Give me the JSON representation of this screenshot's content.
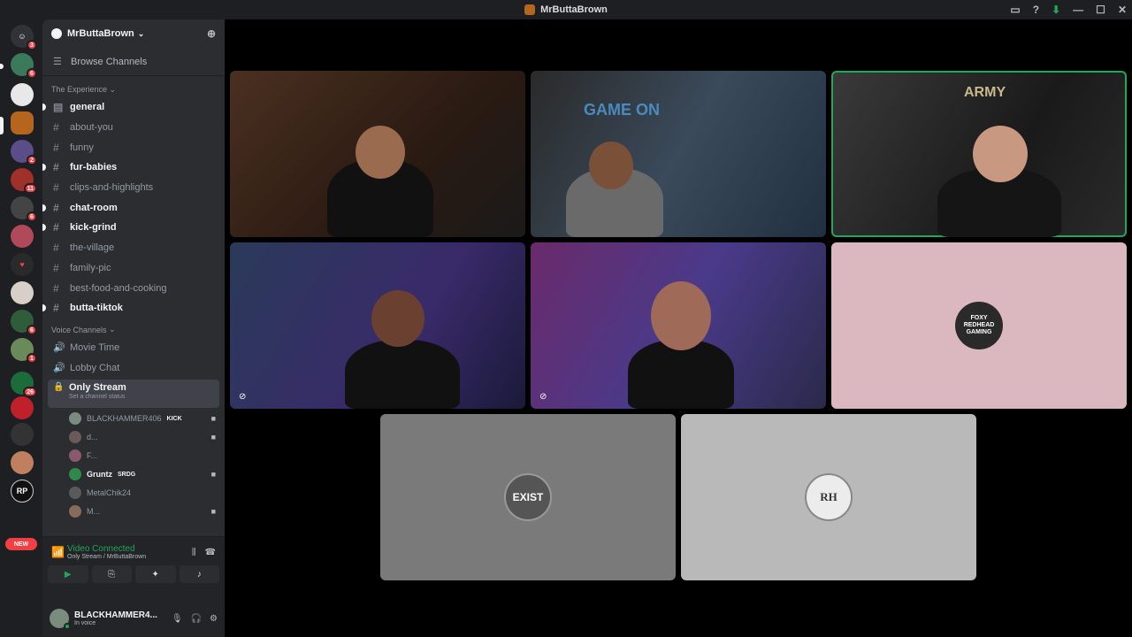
{
  "window": {
    "title": "MrButtaBrown"
  },
  "server": {
    "name": "MrButtaBrown"
  },
  "sidebar": {
    "browse_label": "Browse Channels",
    "category_text": "The Experience",
    "category_voice": "Voice Channels",
    "text_channels": [
      {
        "label": "general",
        "unread": true
      },
      {
        "label": "about-you",
        "unread": false
      },
      {
        "label": "funny",
        "unread": false
      },
      {
        "label": "fur-babies",
        "unread": true
      },
      {
        "label": "clips-and-highlights",
        "unread": false
      },
      {
        "label": "chat-room",
        "unread": true
      },
      {
        "label": "kick-grind",
        "unread": true
      },
      {
        "label": "the-village",
        "unread": false
      },
      {
        "label": "family-pic",
        "unread": false
      },
      {
        "label": "best-food-and-cooking",
        "unread": false
      },
      {
        "label": "butta-tiktok",
        "unread": true
      }
    ],
    "voice_channels": [
      {
        "label": "Movie Time"
      },
      {
        "label": "Lobby Chat"
      }
    ],
    "active_voice": {
      "label": "Only Stream",
      "status": "Set a channel status"
    },
    "voice_users": [
      {
        "name": "BLACKHAMMER406",
        "tag": "KICK",
        "bold": false
      },
      {
        "name": "d...",
        "tag": "",
        "bold": false
      },
      {
        "name": "F...",
        "tag": "",
        "bold": false
      },
      {
        "name": "Gruntz",
        "tag": "SRDG",
        "bold": true
      },
      {
        "name": "MetalChik24",
        "tag": "",
        "bold": false
      },
      {
        "name": "M...",
        "tag": "",
        "bold": false
      }
    ]
  },
  "server_badges": [
    "3",
    "6",
    "2",
    "11",
    "6",
    "6",
    "1",
    "26"
  ],
  "new_label": "NEW",
  "voice_panel": {
    "status": "Video Connected",
    "location": "Only Stream / MrButtaBrown"
  },
  "user": {
    "name": "BLACKHAMMER4...",
    "status": "In voice"
  },
  "tiles": {
    "exist_label": "EXIST",
    "foxy_label": "FOXY REDHEAD GAMING",
    "rh_label": "RH",
    "game_on": "GAME ON",
    "army": "ARMY"
  },
  "colors": {
    "accent": "#23a55a",
    "danger": "#f23f43",
    "bg": "#1e1f22",
    "sidebar": "#2b2d31"
  }
}
